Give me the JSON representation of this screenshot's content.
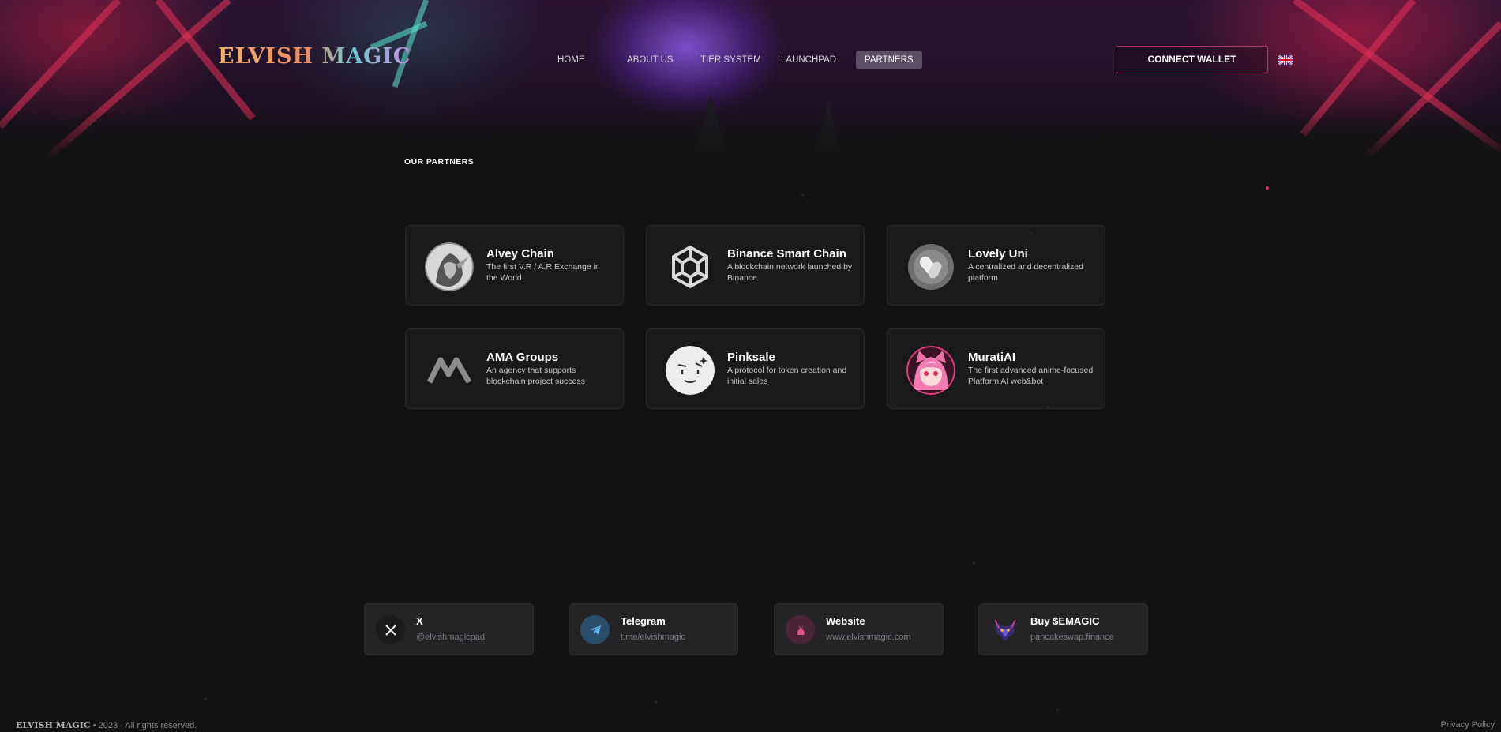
{
  "header": {
    "logo_text": "ELVISH MAGIC",
    "nav": [
      {
        "label": "HOME"
      },
      {
        "label": "ABOUT US"
      },
      {
        "label": "TIER SYSTEM"
      },
      {
        "label": "LAUNCHPAD"
      },
      {
        "label": "PARTNERS",
        "active": true
      }
    ],
    "connect_label": "CONNECT WALLET",
    "language_icon": "uk-flag-icon"
  },
  "section": {
    "title": "OUR PARTNERS"
  },
  "partners": [
    {
      "name": "Alvey Chain",
      "desc": "The first V.R / A.R Exchange in the World",
      "icon": "elf-portrait-icon"
    },
    {
      "name": "Binance Smart Chain",
      "desc": "A blockchain network launched by Binance",
      "icon": "bnb-cube-icon"
    },
    {
      "name": "Lovely Uni",
      "desc": "A centralized and decentralized platform",
      "icon": "lovely-pill-icon"
    },
    {
      "name": "AMA Groups",
      "desc": "An agency that supports blockchain project success",
      "icon": "ama-logo-icon"
    },
    {
      "name": "Pinksale",
      "desc": "A protocol for token creation and initial sales",
      "icon": "pinksale-face-icon"
    },
    {
      "name": "MuratiAI",
      "desc": "The first advanced anime-focused Platform AI web&bot",
      "icon": "anime-girl-icon"
    }
  ],
  "social": [
    {
      "title": "X",
      "sub": "@elvishmagicpad",
      "icon": "x-icon"
    },
    {
      "title": "Telegram",
      "sub": "t.me/elvishmagic",
      "icon": "telegram-icon"
    },
    {
      "title": "Website",
      "sub": "www.elvishmagic.com",
      "icon": "rabbit-icon"
    },
    {
      "title": "Buy $EMAGIC",
      "sub": "pancakeswap.finance",
      "icon": "fox-icon"
    }
  ],
  "footer": {
    "logo": "ELVISH MAGIC",
    "copyright": "• 2023 - All rights reserved.",
    "privacy": "Privacy Policy"
  },
  "colors": {
    "background": "#131213",
    "card": "#1a191b",
    "accent": "#d23c6e",
    "nav_active": "#8c8296"
  }
}
